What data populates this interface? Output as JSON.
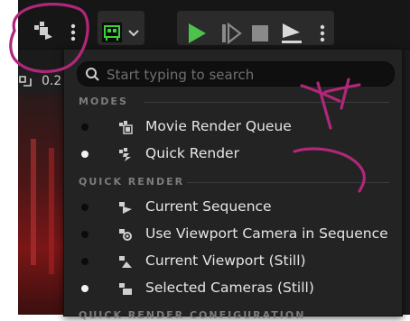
{
  "viewport": {
    "zoom_value": "0.2"
  },
  "search": {
    "placeholder": "Start typing to search"
  },
  "sections": {
    "modes": "MODES",
    "quick_render": "QUICK RENDER",
    "quick_render_config": "QUICK RENDER CONFIGURATION"
  },
  "modes": [
    {
      "label": "Movie Render Queue",
      "selected": false,
      "icon": "movie-render-queue-icon"
    },
    {
      "label": "Quick Render",
      "selected": true,
      "icon": "quick-render-icon"
    }
  ],
  "quick_render": [
    {
      "label": "Current Sequence",
      "selected": false,
      "icon": "sequence-icon"
    },
    {
      "label": "Use Viewport Camera in Sequence",
      "selected": false,
      "icon": "viewport-camera-icon"
    },
    {
      "label": "Current Viewport (Still)",
      "selected": false,
      "icon": "viewport-still-icon"
    },
    {
      "label": "Selected Cameras (Still)",
      "selected": true,
      "icon": "selected-cameras-icon"
    }
  ],
  "colors": {
    "play_green": "#4cc24c",
    "annotation_magenta": "#b0277a",
    "menu_bg": "#232323"
  }
}
